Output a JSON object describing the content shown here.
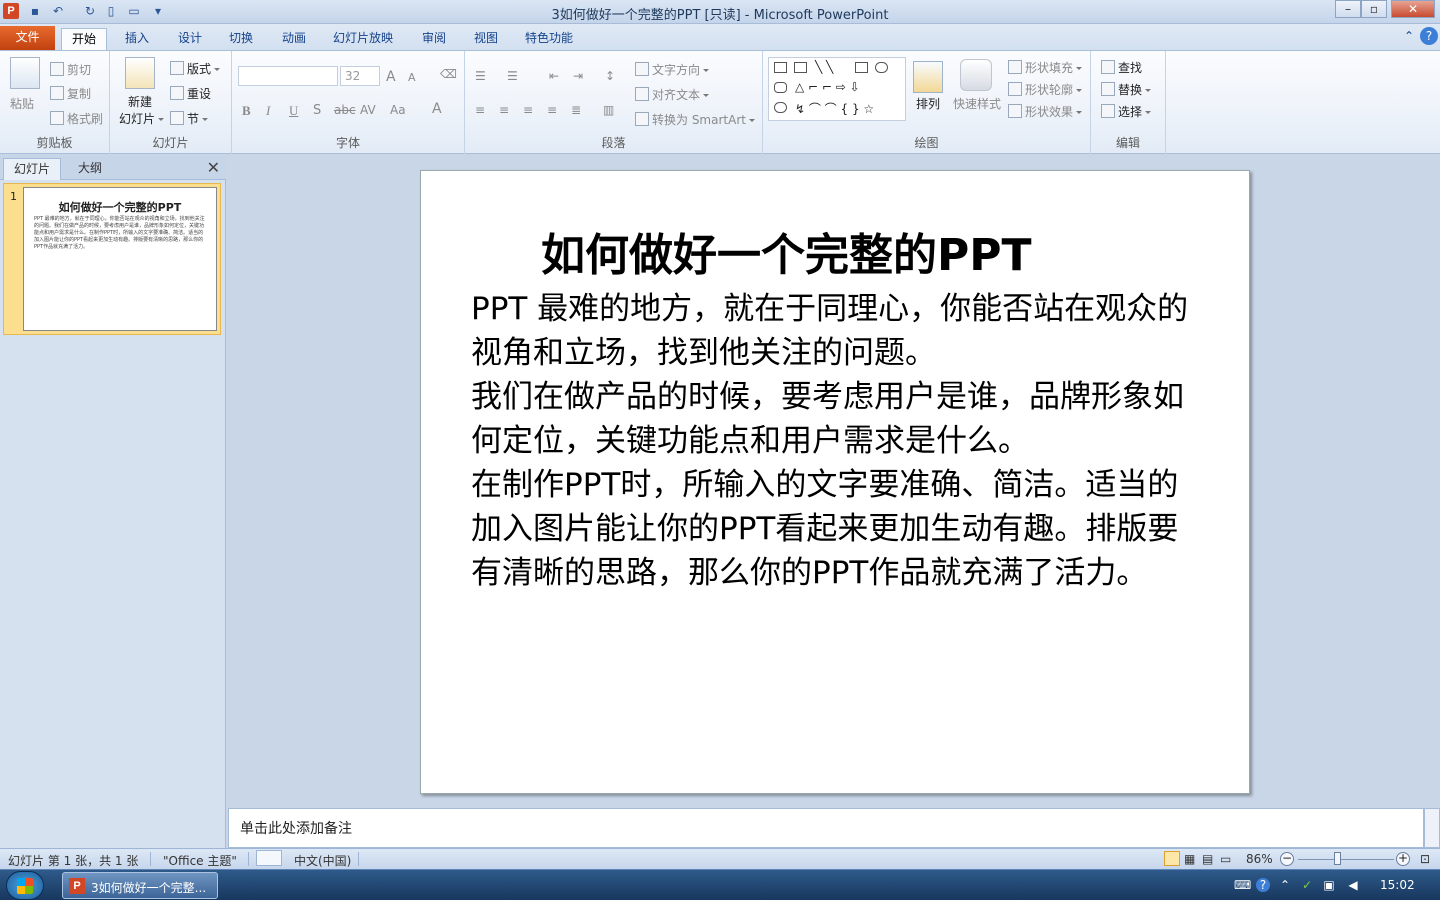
{
  "window": {
    "title": "3如何做好一个完整的PPT [只读] - Microsoft PowerPoint",
    "app_icon": "P",
    "min": "–",
    "max": "▫",
    "close": "✕"
  },
  "tabs": [
    "文件",
    "开始",
    "插入",
    "设计",
    "切换",
    "动画",
    "幻灯片放映",
    "审阅",
    "视图",
    "特色功能"
  ],
  "ribbon": {
    "clipboard": {
      "paste": "粘贴",
      "cut": "剪切",
      "copy": "复制",
      "format_painter": "格式刷",
      "label": "剪贴板"
    },
    "slides": {
      "new_slide_1": "新建",
      "new_slide_2": "幻灯片",
      "layout": "版式",
      "reset": "重设",
      "section": "节",
      "label": "幻灯片"
    },
    "font": {
      "size": "32",
      "label": "字体",
      "bold": "B",
      "italic": "I",
      "underline": "U",
      "shadow": "S",
      "strike": "abc",
      "spacing": "AV",
      "case": "Aa",
      "color": "A",
      "grow": "A",
      "shrink": "A"
    },
    "paragraph": {
      "text_direction": "文字方向",
      "align_text": "对齐文本",
      "smartart": "转换为 SmartArt",
      "label": "段落"
    },
    "drawing": {
      "arrange": "排列",
      "quick_styles": "快速样式",
      "fill": "形状填充",
      "outline": "形状轮廓",
      "effects": "形状效果",
      "label": "绘图"
    },
    "editing": {
      "find": "查找",
      "replace": "替换",
      "select": "选择",
      "label": "编辑"
    }
  },
  "pane": {
    "tab_slides": "幻灯片",
    "tab_outline": "大纲",
    "close": "✕",
    "thumb_number": "1",
    "thumb_title": "如何做好一个完整的PPT",
    "thumb_body": "PPT 最难的地方，就在于同理心，你能否站在观众的视角和立场，找到他关注的问题。我们在做产品的时候，要考虑用户是谁，品牌形象如何定位，关键功能点和用户需求是什么。在制作PPT时，所输入的文字要准确、简洁。适当的加入图片能让你的PPT看起来更加生动有趣。排版要有清晰的思路，那么你的PPT作品就充满了活力。"
  },
  "slide": {
    "title": "如何做好一个完整的PPT",
    "paragraphs": [
      "PPT 最难的地方，就在于同理心，你能否站在观众的视角和立场，找到他关注的问题。",
      "我们在做产品的时候，要考虑用户是谁，品牌形象如何定位，关键功能点和用户需求是什么。",
      "在制作PPT时，所输入的文字要准确、简洁。适当的加入图片能让你的PPT看起来更加生动有趣。排版要有清晰的思路，那么你的PPT作品就充满了活力。"
    ]
  },
  "notes": {
    "placeholder": "单击此处添加备注"
  },
  "status": {
    "slide_info": "幻灯片 第 1 张，共 1 张",
    "theme": "\"Office 主题\"",
    "language": "中文(中国)",
    "zoom": "86%",
    "zoom_level": 0.86
  },
  "taskbar": {
    "task_label": "3如何做好一个完整...",
    "time": "15:02"
  },
  "colors": {
    "file_tab": "#c2410f",
    "accent": "#2b5797",
    "thumb_selected": "#fbdf8f"
  }
}
